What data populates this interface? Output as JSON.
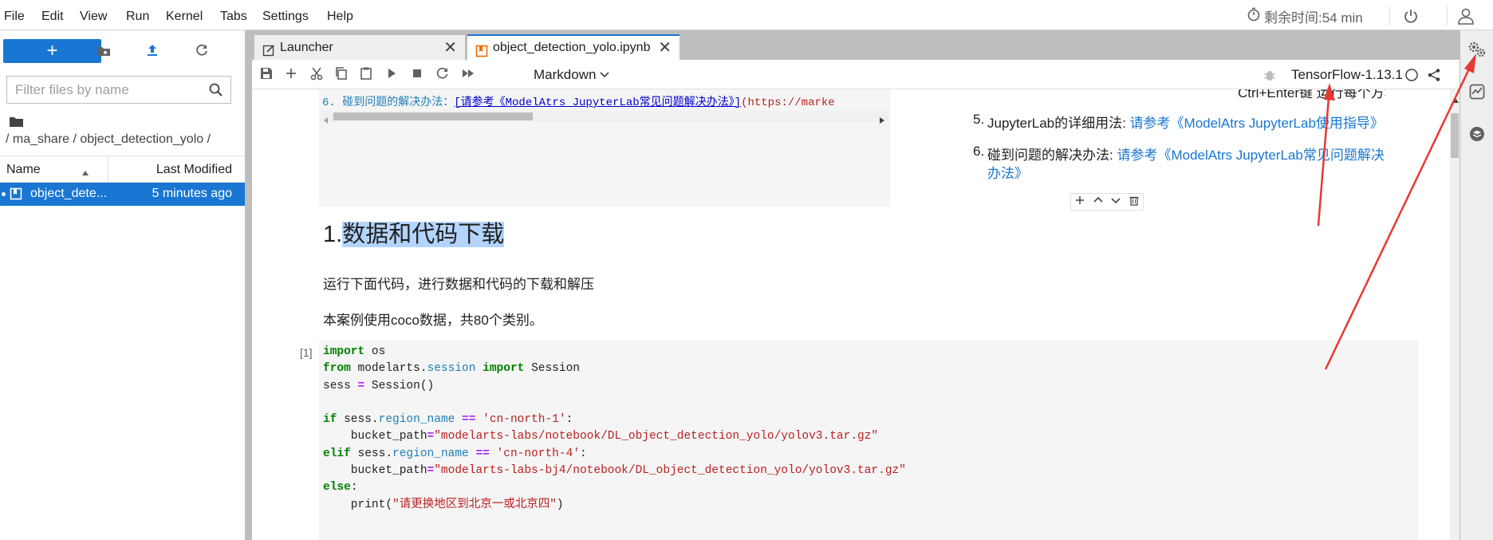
{
  "menu": [
    "File",
    "Edit",
    "View",
    "Run",
    "Kernel",
    "Tabs",
    "Settings",
    "Help"
  ],
  "timer_text": "剩余时间:54 min",
  "filebrowser": {
    "new_button": "+",
    "filter_placeholder": "Filter files by name",
    "breadcrumb": "/ ma_share / object_detection_yolo /",
    "col_name": "Name",
    "col_modified": "Last Modified",
    "files": [
      {
        "name": "object_dete...",
        "modified": "5 minutes ago"
      }
    ]
  },
  "tabs": [
    {
      "label": "Launcher",
      "active": false
    },
    {
      "label": "object_detection_yolo.ipynb",
      "active": true
    }
  ],
  "toolbar": {
    "cell_type": "Markdown",
    "kernel": "TensorFlow-1.13.1"
  },
  "notebook": {
    "output_line": "6. 碰到问题的解决办法：",
    "output_link": "[请参考《ModelAtrs JupyterLab常见问题解决办法》]",
    "output_url": "(https://marke",
    "right_top_partial": "Ctrl+Enter键 运行每个方块中的代码",
    "item5_num": "5.",
    "item5_text": "JupyterLab的详细用法: ",
    "item5_link": "请参考《ModelAtrs JupyterLab使用指导》",
    "item6_num": "6.",
    "item6_text": "碰到问题的解决办法: ",
    "item6_link_a": "请参考《ModelAtrs JupyterLab常见问题解决",
    "item6_link_b": "办法》",
    "heading_num": "1.",
    "heading_text": "数据和代码下载",
    "para1": "运行下面代码，进行数据和代码的下载和解压",
    "para2": "本案例使用coco数据，共80个类别。",
    "prompt": "[1]",
    "code": {
      "l1_kw": "import",
      "l1_rest": " os",
      "l2_kw1": "from",
      "l2_mod": " modelarts.",
      "l2_attr": "session",
      "l2_kw2": " import",
      "l2_rest": " Session",
      "l3_a": "sess ",
      "l3_op": "=",
      "l3_b": " Session()",
      "l5_kw": "if",
      "l5_a": " sess.",
      "l5_attr": "region_name",
      "l5_op": " ==",
      "l5_str": " 'cn-north-1'",
      "l5_end": ":",
      "l6_a": "    bucket_path",
      "l6_op": "=",
      "l6_str": "\"modelarts-labs/notebook/DL_object_detection_yolo/yolov3.tar.gz\"",
      "l7_kw": "elif",
      "l7_a": " sess.",
      "l7_attr": "region_name",
      "l7_op": " ==",
      "l7_str": " 'cn-north-4'",
      "l7_end": ":",
      "l8_a": "    bucket_path",
      "l8_op": "=",
      "l8_str": "\"modelarts-labs-bj4/notebook/DL_object_detection_yolo/yolov3.tar.gz\"",
      "l9_kw": "else",
      "l9_end": ":",
      "l10_a": "    print(",
      "l10_str": "\"请更换地区到北京一或北京四\"",
      "l10_end": ")"
    }
  },
  "colors": {
    "accent": "#1976d2",
    "annotation": "#e53935"
  }
}
